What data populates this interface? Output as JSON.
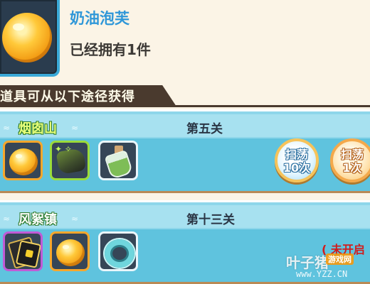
{
  "item": {
    "name": "奶油泡芙",
    "owned": "已经拥有1件",
    "icon": "cream-puff-icon"
  },
  "sources": {
    "title": "道具可从以下途径获得"
  },
  "stages": [
    {
      "name": "烟囱山",
      "level": "第五关",
      "drops": [
        "cream-puff-icon",
        "tree-stump-icon",
        "potion-bottle-icon"
      ],
      "sweep_10": {
        "line1": "扫荡",
        "line2": "10次"
      },
      "sweep_1": {
        "line1": "扫荡",
        "line2": "1次"
      }
    },
    {
      "name": "风絮镇",
      "level": "第十三关",
      "drops": [
        "card-bundle-icon",
        "cream-puff-icon",
        "ring-icon"
      ],
      "status": "( 未开启"
    }
  ],
  "watermark": {
    "brand": "叶子猪",
    "tag": "游戏网",
    "url": "www.YZZ.CN"
  },
  "colors": {
    "background": "#fbf4e6",
    "accent_blue": "#2f97d8",
    "card_blue": "#8ed6ea",
    "banner_brown": "#4a3a2e",
    "locked_red": "#d11c1c"
  }
}
